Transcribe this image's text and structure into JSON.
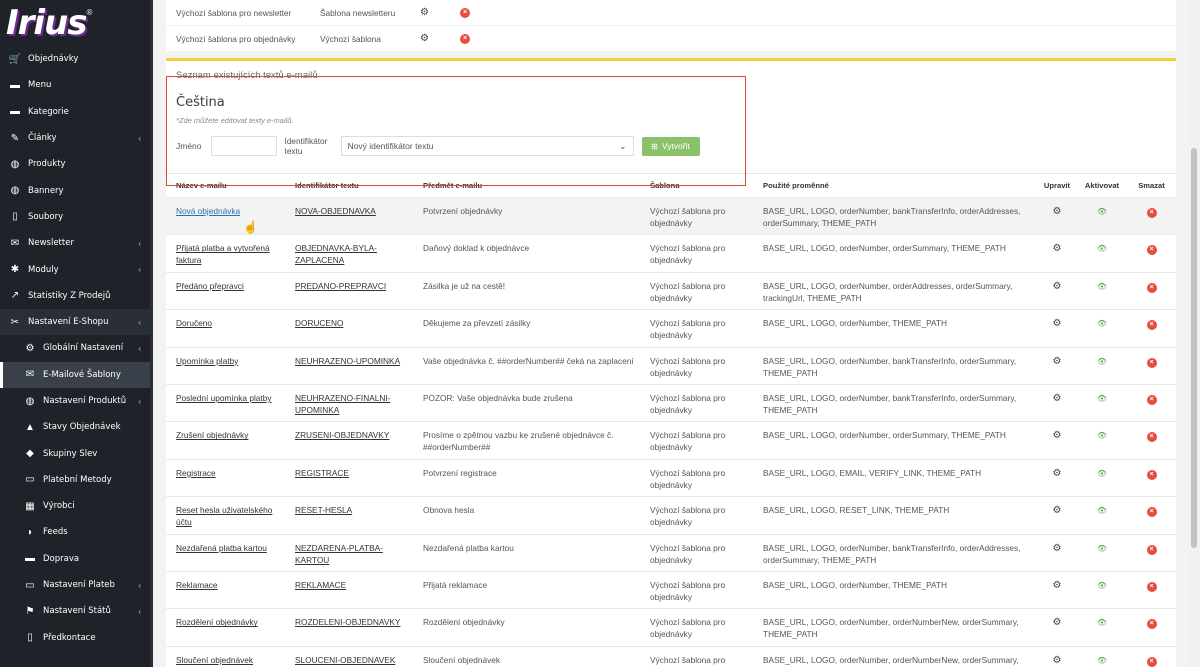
{
  "brand": {
    "logo": "Irius",
    "reg": "®"
  },
  "sidebar": {
    "items": [
      {
        "label": "Objednávky",
        "icon": "cart-icon",
        "glyph": "🛒",
        "chev": ""
      },
      {
        "label": "Menu",
        "icon": "folder-icon",
        "glyph": "▬",
        "chev": ""
      },
      {
        "label": "Kategorie",
        "icon": "folder-icon",
        "glyph": "▬",
        "chev": ""
      },
      {
        "label": "Články",
        "icon": "pencil-icon",
        "glyph": "✎",
        "chev": "‹"
      },
      {
        "label": "Produkty",
        "icon": "globe-icon",
        "glyph": "◍",
        "chev": ""
      },
      {
        "label": "Bannery",
        "icon": "globe-icon",
        "glyph": "◍",
        "chev": ""
      },
      {
        "label": "Soubory",
        "icon": "file-icon",
        "glyph": "▯",
        "chev": ""
      },
      {
        "label": "Newsletter",
        "icon": "mail-icon",
        "glyph": "✉",
        "chev": "‹"
      },
      {
        "label": "Moduly",
        "icon": "puzzle-icon",
        "glyph": "✱",
        "chev": "‹"
      },
      {
        "label": "Statistiky Z Prodejů",
        "icon": "chart-icon",
        "glyph": "↗",
        "chev": ""
      },
      {
        "label": "Nastavení E-Shopu",
        "icon": "tools-icon",
        "glyph": "✂",
        "chev": "‹"
      },
      {
        "label": "Globální Nastavení",
        "icon": "gear-icon",
        "glyph": "⚙",
        "chev": "‹",
        "sub": true
      },
      {
        "label": "E-Mailové Šablony",
        "icon": "envelope-icon",
        "glyph": "✉",
        "chev": "",
        "sub": true,
        "active": true
      },
      {
        "label": "Nastavení Produktů",
        "icon": "globe-icon",
        "glyph": "◍",
        "chev": "‹",
        "sub": true
      },
      {
        "label": "Stavy Objednávek",
        "icon": "truck-icon",
        "glyph": "▲",
        "chev": "",
        "sub": true
      },
      {
        "label": "Skupiny Slev",
        "icon": "tag-icon",
        "glyph": "◆",
        "chev": "",
        "sub": true
      },
      {
        "label": "Platební Metody",
        "icon": "card-icon",
        "glyph": "▭",
        "chev": "",
        "sub": true
      },
      {
        "label": "Výrobci",
        "icon": "building-icon",
        "glyph": "▦",
        "chev": "",
        "sub": true
      },
      {
        "label": "Feeds",
        "icon": "rss-icon",
        "glyph": "◗",
        "chev": "",
        "sub": true
      },
      {
        "label": "Doprava",
        "icon": "truck-icon",
        "glyph": "▬",
        "chev": "",
        "sub": true
      },
      {
        "label": "Nastavení Plateb",
        "icon": "money-icon",
        "glyph": "▭",
        "chev": "‹",
        "sub": true
      },
      {
        "label": "Nastavení Států",
        "icon": "flag-icon",
        "glyph": "⚑",
        "chev": "‹",
        "sub": true
      },
      {
        "label": "Předkontace",
        "icon": "doc-icon",
        "glyph": "▯",
        "chev": "",
        "sub": true
      }
    ]
  },
  "templates": [
    {
      "label": "Výchozí šablona pro newsletter",
      "value": "Šablona newsletteru"
    },
    {
      "label": "Výchozí šablona pro objednávky",
      "value": "Výchozí šablona"
    }
  ],
  "list": {
    "title": "Seznam existujících textů e-mailů",
    "lang": "Čeština",
    "hint": "*Zde můžete editovat texty e-mailů.",
    "name_label": "Jméno",
    "id_label": "Identifikátor textu",
    "select_value": "Nový identifikátor textu",
    "create_label": "Vytvořit"
  },
  "table": {
    "headers": [
      "Název e-mailu",
      "Identifikátor textu",
      "Předmět e-mailu",
      "Šablona",
      "Použité proměnné",
      "Upravit",
      "Aktivovat",
      "Smazat"
    ],
    "rows": [
      {
        "name": "Nová objednávka",
        "id": "NOVA-OBJEDNAVKA",
        "subject": "Potvrzení objednávky",
        "template": "Výchozí šablona pro objednávky",
        "vars": "BASE_URL, LOGO, orderNumber, bankTransferInfo, orderAddresses, orderSummary, THEME_PATH"
      },
      {
        "name": "Přijatá platba a vytvořená faktura",
        "id": "OBJEDNAVKA-BYLA-ZAPLACENA",
        "subject": "Daňový doklad k objednávce",
        "template": "Výchozí šablona pro objednávky",
        "vars": "BASE_URL, LOGO, orderNumber, orderSummary, THEME_PATH"
      },
      {
        "name": "Předáno přepravci",
        "id": "PREDANO-PREPRAVCI",
        "subject": "Zásilka je už na cestě!",
        "template": "Výchozí šablona pro objednávky",
        "vars": "BASE_URL, LOGO, orderNumber, orderAddresses, orderSummary, trackingUrl, THEME_PATH"
      },
      {
        "name": "Doručeno",
        "id": "DORUCENO",
        "subject": "Děkujeme za převzetí zásilky",
        "template": "Výchozí šablona pro objednávky",
        "vars": "BASE_URL, LOGO, orderNumber, THEME_PATH"
      },
      {
        "name": "Upomínka platby",
        "id": "NEUHRAZENO-UPOMINKA",
        "subject": "Vaše objednávka č. ##orderNumber## čeká na zaplacení",
        "template": "Výchozí šablona pro objednávky",
        "vars": "BASE_URL, LOGO, orderNumber, bankTransferInfo, orderSummary, THEME_PATH"
      },
      {
        "name": "Poslední upomínka platby",
        "id": "NEUHRAZENO-FINALNI-UPOMINKA",
        "subject": "POZOR: Vaše objednávka bude zrušena",
        "template": "Výchozí šablona pro objednávky",
        "vars": "BASE_URL, LOGO, orderNumber, bankTransferInfo, orderSummary, THEME_PATH"
      },
      {
        "name": "Zrušení objednávky",
        "id": "ZRUSENI-OBJEDNAVKY",
        "subject": "Prosíme o zpětnou vazbu ke zrušené objednávce č. ##orderNumber##",
        "template": "Výchozí šablona pro objednávky",
        "vars": "BASE_URL, LOGO, orderNumber, orderSummary, THEME_PATH"
      },
      {
        "name": "Registrace",
        "id": "REGISTRACE",
        "subject": "Potvrzení registrace",
        "template": "Výchozí šablona pro objednávky",
        "vars": "BASE_URL, LOGO, EMAIL, VERIFY_LINK, THEME_PATH"
      },
      {
        "name": "Reset hesla uživatelského účtu",
        "id": "RESET-HESLA",
        "subject": "Obnova hesla",
        "template": "Výchozí šablona pro objednávky",
        "vars": "BASE_URL, LOGO, RESET_LINK, THEME_PATH"
      },
      {
        "name": "Nezdařená platba kartou",
        "id": "NEZDARENA-PLATBA-KARTOU",
        "subject": "Nezdařená platba kartou",
        "template": "Výchozí šablona pro objednávky",
        "vars": "BASE_URL, LOGO, orderNumber, bankTransferInfo, orderAddresses, orderSummary, THEME_PATH"
      },
      {
        "name": "Reklamace",
        "id": "REKLAMACE",
        "subject": "Přijatá reklamace",
        "template": "Výchozí šablona pro objednávky",
        "vars": "BASE_URL, LOGO, orderNumber, THEME_PATH"
      },
      {
        "name": "Rozdělení objednávky",
        "id": "ROZDELENI-OBJEDNAVKY",
        "subject": "Rozdělení objednávky",
        "template": "Výchozí šablona pro objednávky",
        "vars": "BASE_URL, LOGO, orderNumber, orderNumberNew, orderSummary, THEME_PATH"
      },
      {
        "name": "Sloučení objednávek",
        "id": "SLOUCENI-OBJEDNAVEK",
        "subject": "Sloučení objednávek",
        "template": "Výchozí šablona pro objednávky",
        "vars": "BASE_URL, LOGO, orderNumber, orderNumberNew, orderSummary,"
      }
    ]
  },
  "colors": {
    "sidebar": "#1f2329",
    "accent_yellow": "#f4cf3a",
    "create_button": "#8cc16b",
    "highlight_box": "#d9473b",
    "eye": "#4caf50",
    "delete": "#e74c3c"
  }
}
